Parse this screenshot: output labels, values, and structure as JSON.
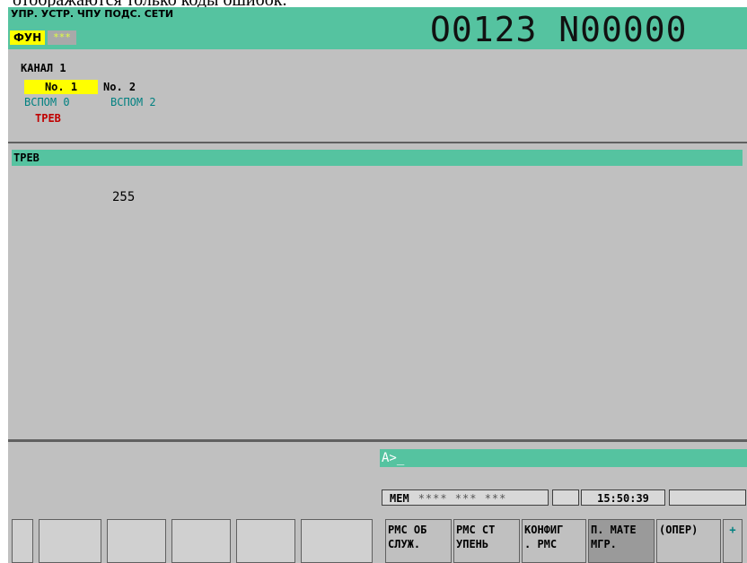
{
  "caption": "отображаются только коды ошибок.",
  "header": {
    "title": "УПР. УСТР. ЧПУ ПОДС. СЕТИ",
    "func_label": "ФУН",
    "func_stars": "***",
    "program_number": "O0123 N00000"
  },
  "channel": {
    "title": "КАНАЛ 1",
    "tab1": "No. 1",
    "tab2": "No. 2",
    "sub0": "ВСПОМ 0",
    "sub2": "ВСПОМ 2",
    "alarm": "ТРЕВ"
  },
  "section": {
    "title": "ТРЕВ",
    "value": "255"
  },
  "input": {
    "prompt": "A>_"
  },
  "status": {
    "mode": "MEM",
    "stars": "**** *** ***",
    "time": "15:50:39"
  },
  "softkeys": [
    "",
    "",
    "",
    "",
    "",
    "",
    "PMC ОБ\nСЛУЖ.",
    "PMC СТ\nУПЕНЬ",
    "КОНФИГ\n. PMC",
    "П. МАТЕ\nМГР.",
    "(ОПЕР)",
    "+"
  ]
}
